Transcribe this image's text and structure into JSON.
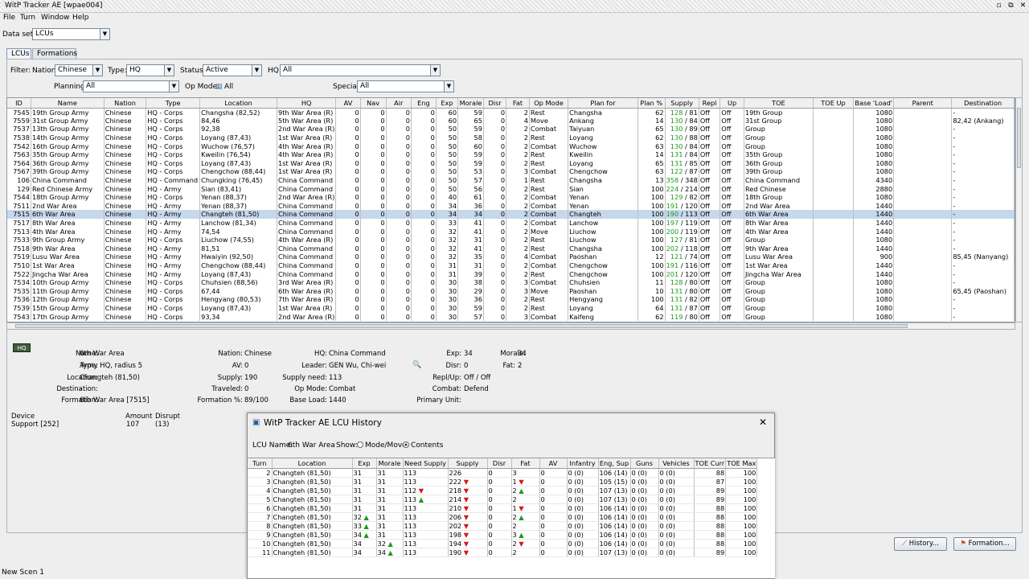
{
  "window": {
    "title": "WitP Tracker AE [wpae004]"
  },
  "menu": [
    "File",
    "Turn",
    "Window",
    "Help"
  ],
  "dataset": {
    "label": "Data set:",
    "value": "LCUs"
  },
  "tabs": [
    "LCUs",
    "Formations"
  ],
  "filter": {
    "label": "Filter:",
    "nation_label": "Nation:",
    "nation": "Chinese",
    "type_label": "Type:",
    "type": "HQ",
    "status_label": "Status:",
    "status": "Active",
    "hq_label": "HQ:",
    "hq": "All",
    "planning_label": "Planning:",
    "planning": "All",
    "opmode_label": "Op Mode:",
    "opmode": "All",
    "special_label": "Special:",
    "special": "All"
  },
  "grid": {
    "columns": [
      "ID",
      "Name",
      "Nation",
      "Type",
      "Location",
      "HQ",
      "AV",
      "Nav",
      "Air",
      "Eng",
      "Exp",
      "Morale",
      "Disr",
      "Fat",
      "Op Mode",
      "Plan for",
      "Plan %",
      "Supply",
      "Repl",
      "Up",
      "TOE",
      "TOE Up",
      "Base 'Load'",
      "Parent",
      "Destination"
    ],
    "rows": [
      [
        "7545",
        "19th Group Army",
        "Chinese",
        "HQ - Corps",
        "Changsha (82,52)",
        "9th War Area (R)",
        "0",
        "0",
        "0",
        "0",
        "60",
        "59",
        "0",
        "2",
        "Rest",
        "Changsha",
        "62",
        "128 / 81",
        "Off",
        "Off",
        "19th Group",
        "",
        "1080",
        "",
        "-"
      ],
      [
        "7559",
        "31st Group Army",
        "Chinese",
        "HQ - Corps",
        "84,46",
        "5th War Area (R)",
        "0",
        "0",
        "0",
        "0",
        "60",
        "65",
        "0",
        "4",
        "Move",
        "Ankang",
        "14",
        "130 / 84",
        "Off",
        "Off",
        "31st Group",
        "",
        "1080",
        "",
        "82,42 (Ankang)"
      ],
      [
        "7537",
        "13th Group Army",
        "Chinese",
        "HQ - Corps",
        "92,38",
        "2nd War Area (R)",
        "0",
        "0",
        "0",
        "0",
        "50",
        "59",
        "0",
        "2",
        "Combat",
        "Taiyuan",
        "65",
        "130 / 89",
        "Off",
        "Off",
        "Group",
        "",
        "1080",
        "",
        "-"
      ],
      [
        "7538",
        "14th Group Army",
        "Chinese",
        "HQ - Corps",
        "Loyang (87,43)",
        "1st War Area (R)",
        "0",
        "0",
        "0",
        "0",
        "50",
        "58",
        "0",
        "2",
        "Rest",
        "Loyang",
        "62",
        "130 / 88",
        "Off",
        "Off",
        "Group",
        "",
        "1080",
        "",
        "-"
      ],
      [
        "7542",
        "16th Group Army",
        "Chinese",
        "HQ - Corps",
        "Wuchow (76,57)",
        "4th War Area (R)",
        "0",
        "0",
        "0",
        "0",
        "50",
        "60",
        "0",
        "2",
        "Combat",
        "Wuchow",
        "63",
        "130 / 84",
        "Off",
        "Off",
        "Group",
        "",
        "1080",
        "",
        "-"
      ],
      [
        "7563",
        "35th Group Army",
        "Chinese",
        "HQ - Corps",
        "Kweilin (76,54)",
        "4th War Area (R)",
        "0",
        "0",
        "0",
        "0",
        "50",
        "59",
        "0",
        "2",
        "Rest",
        "Kweilin",
        "14",
        "131 / 84",
        "Off",
        "Off",
        "35th Group",
        "",
        "1080",
        "",
        "-"
      ],
      [
        "7564",
        "36th Group Army",
        "Chinese",
        "HQ - Corps",
        "Loyang (87,43)",
        "1st War Area (R)",
        "0",
        "0",
        "0",
        "0",
        "50",
        "59",
        "0",
        "2",
        "Rest",
        "Loyang",
        "65",
        "131 / 85",
        "Off",
        "Off",
        "36th Group",
        "",
        "1080",
        "",
        "-"
      ],
      [
        "7567",
        "39th Group Army",
        "Chinese",
        "HQ - Corps",
        "Chengchow (88,44)",
        "1st War Area (R)",
        "0",
        "0",
        "0",
        "0",
        "50",
        "53",
        "0",
        "3",
        "Combat",
        "Chengchow",
        "63",
        "122 / 87",
        "Off",
        "Off",
        "39th Group",
        "",
        "1080",
        "",
        "-"
      ],
      [
        "106",
        "China Command",
        "Chinese",
        "HQ - Command",
        "Chungking (76,45)",
        "China Command",
        "0",
        "0",
        "0",
        "0",
        "50",
        "57",
        "0",
        "1",
        "Rest",
        "Changsha",
        "13",
        "358 / 348",
        "Off",
        "Off",
        "China Command",
        "",
        "4340",
        "",
        "-"
      ],
      [
        "129",
        "Red Chinese Army",
        "Chinese",
        "HQ - Army",
        "Sian (83,41)",
        "China Command",
        "0",
        "0",
        "0",
        "0",
        "50",
        "56",
        "0",
        "2",
        "Rest",
        "Sian",
        "100",
        "224 / 214",
        "Off",
        "Off",
        "Red Chinese",
        "",
        "2880",
        "",
        "-"
      ],
      [
        "7544",
        "18th Group Army",
        "Chinese",
        "HQ - Corps",
        "Yenan (88,37)",
        "2nd War Area (R)",
        "0",
        "0",
        "0",
        "0",
        "40",
        "61",
        "0",
        "2",
        "Combat",
        "Yenan",
        "100",
        "129 / 82",
        "Off",
        "Off",
        "18th Group",
        "",
        "1080",
        "",
        "-"
      ],
      [
        "7511",
        "2nd War Area",
        "Chinese",
        "HQ - Army",
        "Yenan (88,37)",
        "China Command",
        "0",
        "0",
        "0",
        "0",
        "34",
        "36",
        "0",
        "2",
        "Combat",
        "Yenan",
        "100",
        "191 / 120",
        "Off",
        "Off",
        "2nd War Area",
        "",
        "1440",
        "",
        "-"
      ],
      [
        "7515",
        "6th War Area",
        "Chinese",
        "HQ - Army",
        "Changteh (81,50)",
        "China Command",
        "0",
        "0",
        "0",
        "0",
        "34",
        "34",
        "0",
        "2",
        "Combat",
        "Changteh",
        "100",
        "190 / 113",
        "Off",
        "Off",
        "6th War Area",
        "",
        "1440",
        "",
        "-"
      ],
      [
        "7517",
        "8th War Area",
        "Chinese",
        "HQ - Army",
        "Lanchow (81,34)",
        "China Command",
        "0",
        "0",
        "0",
        "0",
        "33",
        "41",
        "0",
        "2",
        "Combat",
        "Lanchow",
        "100",
        "197 / 119",
        "Off",
        "Off",
        "8th War Area",
        "",
        "1440",
        "",
        "-"
      ],
      [
        "7513",
        "4th War Area",
        "Chinese",
        "HQ - Army",
        "74,54",
        "China Command",
        "0",
        "0",
        "0",
        "0",
        "32",
        "41",
        "0",
        "2",
        "Move",
        "Liuchow",
        "100",
        "200 / 119",
        "Off",
        "Off",
        "4th War Area",
        "",
        "1440",
        "",
        "-"
      ],
      [
        "7533",
        "9th Group Army",
        "Chinese",
        "HQ - Corps",
        "Liuchow (74,55)",
        "4th War Area (R)",
        "0",
        "0",
        "0",
        "0",
        "32",
        "31",
        "0",
        "2",
        "Rest",
        "Liuchow",
        "100",
        "127 / 81",
        "Off",
        "Off",
        "Group",
        "",
        "1080",
        "",
        "-"
      ],
      [
        "7518",
        "9th War Area",
        "Chinese",
        "HQ - Army",
        "81,51",
        "China Command",
        "0",
        "0",
        "0",
        "0",
        "32",
        "41",
        "0",
        "2",
        "Rest",
        "Changsha",
        "100",
        "202 / 118",
        "Off",
        "Off",
        "9th War Area",
        "",
        "1440",
        "",
        "-"
      ],
      [
        "7519",
        "Lusu War Area",
        "Chinese",
        "HQ - Army",
        "Hwaiyin (92,50)",
        "China Command",
        "0",
        "0",
        "0",
        "0",
        "32",
        "35",
        "0",
        "4",
        "Combat",
        "Paoshan",
        "12",
        "121 / 74",
        "Off",
        "Off",
        "Lusu War Area",
        "",
        "900",
        "",
        "85,45 (Nanyang)"
      ],
      [
        "7510",
        "1st War Area",
        "Chinese",
        "HQ - Army",
        "Chengchow (88,44)",
        "China Command",
        "0",
        "0",
        "0",
        "0",
        "31",
        "31",
        "0",
        "2",
        "Combat",
        "Chengchow",
        "100",
        "191 / 116",
        "Off",
        "Off",
        "1st War Area",
        "",
        "1440",
        "",
        "-"
      ],
      [
        "7522",
        "Jingcha War Area",
        "Chinese",
        "HQ - Army",
        "Loyang (87,43)",
        "China Command",
        "0",
        "0",
        "0",
        "0",
        "31",
        "39",
        "0",
        "2",
        "Rest",
        "Chengchow",
        "100",
        "201 / 120",
        "Off",
        "Off",
        "Jingcha War Area",
        "",
        "1440",
        "",
        "-"
      ],
      [
        "7534",
        "10th Group Army",
        "Chinese",
        "HQ - Corps",
        "Chuhsien (88,56)",
        "3rd War Area (R)",
        "0",
        "0",
        "0",
        "0",
        "30",
        "38",
        "0",
        "3",
        "Combat",
        "Chuhsien",
        "11",
        "128 / 80",
        "Off",
        "Off",
        "Group",
        "",
        "1080",
        "",
        "-"
      ],
      [
        "7535",
        "11th Group Army",
        "Chinese",
        "HQ - Corps",
        "67,44",
        "6th War Area (R)",
        "0",
        "0",
        "0",
        "0",
        "30",
        "29",
        "0",
        "3",
        "Move",
        "Paoshan",
        "10",
        "131 / 80",
        "Off",
        "Off",
        "Group",
        "",
        "1080",
        "",
        "65,45 (Paoshan)"
      ],
      [
        "7536",
        "12th Group Army",
        "Chinese",
        "HQ - Corps",
        "Hengyang (80,53)",
        "7th War Area (R)",
        "0",
        "0",
        "0",
        "0",
        "30",
        "36",
        "0",
        "2",
        "Rest",
        "Hengyang",
        "100",
        "131 / 82",
        "Off",
        "Off",
        "Group",
        "",
        "1080",
        "",
        "-"
      ],
      [
        "7539",
        "15th Group Army",
        "Chinese",
        "HQ - Corps",
        "Loyang (87,43)",
        "1st War Area (R)",
        "0",
        "0",
        "0",
        "0",
        "30",
        "59",
        "0",
        "2",
        "Rest",
        "Loyang",
        "64",
        "131 / 87",
        "Off",
        "Off",
        "Group",
        "",
        "1080",
        "",
        "-"
      ],
      [
        "7543",
        "17th Group Army",
        "Chinese",
        "HQ - Corps",
        "93,34",
        "2nd War Area (R)",
        "0",
        "0",
        "0",
        "0",
        "30",
        "57",
        "0",
        "3",
        "Combat",
        "Kaifeng",
        "62",
        "119 / 80",
        "Off",
        "Off",
        "Group",
        "",
        "1080",
        "",
        "-"
      ]
    ]
  },
  "details": {
    "badge": "HQ",
    "name_l": "Name:",
    "name": "6th War Area",
    "type_l": "Type:",
    "type": "Army HQ, radius 5",
    "location_l": "Location:",
    "location": "Changteh (81,50)",
    "destination_l": "Destination:",
    "destination": "-",
    "formation_l": "Formation:",
    "formation": "6th War Area [7515]",
    "nation_l": "Nation:",
    "nation": "Chinese",
    "av_l": "AV:",
    "av": "0",
    "supply_l": "Supply:",
    "supply": "190",
    "traveled_l": "Traveled:",
    "traveled": "0",
    "formpct_l": "Formation %:",
    "formpct": "89/100",
    "hq_l": "HQ:",
    "hq": "China Command",
    "leader_l": "Leader:",
    "leader": "GEN Wu, Chi-wei",
    "supplyneed_l": "Supply need:",
    "supplyneed": "113",
    "opmode_l": "Op Mode:",
    "opmode": "Combat",
    "baseload_l": "Base Load:",
    "baseload": "1440",
    "exp_l": "Exp:",
    "exp": "34",
    "disr_l": "Disr:",
    "disr": "0",
    "replup_l": "Repl/Up:",
    "replup": "Off / Off",
    "combat_l": "Combat:",
    "combat": "Defend",
    "primary_l": "Primary Unit:",
    "primary": "",
    "morale_l": "Morale:",
    "morale": "34",
    "fat_l": "Fat:",
    "fat": "2",
    "device_h": "Device",
    "amount_h": "Amount",
    "disrupt_h": "Disrupt",
    "device": "Support [252]",
    "amount": "107",
    "disrupt": "(13)"
  },
  "history": {
    "title": "WitP Tracker AE LCU History",
    "lcu_label": "LCU Name:",
    "lcu_name": "6th War Area",
    "show_label": "Show:",
    "opt1": "Mode/Move",
    "opt2": "Contents",
    "columns": [
      "Turn",
      "Location",
      "Exp",
      "Morale",
      "Need Supply",
      "Supply",
      "Disr",
      "Fat",
      "AV",
      "Infantry",
      "Eng, Sup",
      "Guns",
      "Vehicles",
      "TOE Curr",
      "TOE Max"
    ],
    "rows": [
      [
        "2",
        "Changteh (81,50)",
        "31",
        "31",
        "113",
        "226",
        "0",
        "3",
        "0",
        "0 (0)",
        "106 (14)",
        "0 (0)",
        "0 (0)",
        "88",
        "100"
      ],
      [
        "3",
        "Changteh (81,50)",
        "31",
        "31",
        "113",
        "222",
        "0",
        "1",
        "0",
        "0 (0)",
        "105 (15)",
        "0 (0)",
        "0 (0)",
        "87",
        "100"
      ],
      [
        "4",
        "Changteh (81,50)",
        "31",
        "31",
        "112",
        "218",
        "0",
        "2",
        "0",
        "0 (0)",
        "107 (13)",
        "0 (0)",
        "0 (0)",
        "89",
        "100"
      ],
      [
        "5",
        "Changteh (81,50)",
        "31",
        "31",
        "113",
        "214",
        "0",
        "2",
        "0",
        "0 (0)",
        "107 (13)",
        "0 (0)",
        "0 (0)",
        "89",
        "100"
      ],
      [
        "6",
        "Changteh (81,50)",
        "31",
        "31",
        "113",
        "210",
        "0",
        "1",
        "0",
        "0 (0)",
        "106 (14)",
        "0 (0)",
        "0 (0)",
        "88",
        "100"
      ],
      [
        "7",
        "Changteh (81,50)",
        "32",
        "31",
        "113",
        "206",
        "0",
        "2",
        "0",
        "0 (0)",
        "106 (14)",
        "0 (0)",
        "0 (0)",
        "88",
        "100"
      ],
      [
        "8",
        "Changteh (81,50)",
        "33",
        "31",
        "113",
        "202",
        "0",
        "2",
        "0",
        "0 (0)",
        "106 (14)",
        "0 (0)",
        "0 (0)",
        "88",
        "100"
      ],
      [
        "9",
        "Changteh (81,50)",
        "34",
        "31",
        "113",
        "198",
        "0",
        "3",
        "0",
        "0 (0)",
        "106 (14)",
        "0 (0)",
        "0 (0)",
        "88",
        "100"
      ],
      [
        "10",
        "Changteh (81,50)",
        "34",
        "32",
        "113",
        "194",
        "0",
        "2",
        "0",
        "0 (0)",
        "106 (14)",
        "0 (0)",
        "0 (0)",
        "88",
        "100"
      ],
      [
        "11",
        "Changteh (81,50)",
        "34",
        "34",
        "113",
        "190",
        "0",
        "2",
        "0",
        "0 (0)",
        "107 (13)",
        "0 (0)",
        "0 (0)",
        "89",
        "100"
      ]
    ],
    "trends": {
      "exp": [
        "",
        "",
        "",
        "",
        "",
        "up",
        "up",
        "up",
        "",
        ""
      ],
      "morale": [
        "",
        "",
        "",
        "",
        "",
        "",
        "",
        "",
        "up",
        "up"
      ],
      "need": [
        "",
        "",
        "dn",
        "up",
        "",
        "",
        "",
        "",
        "",
        ""
      ],
      "supply": [
        "",
        "dn",
        "dn",
        "dn",
        "dn",
        "dn",
        "dn",
        "dn",
        "dn",
        "dn"
      ],
      "fat": [
        "",
        "dn",
        "up",
        "",
        "dn",
        "up",
        "",
        "up",
        "dn",
        ""
      ]
    }
  },
  "buttons": {
    "history": "History...",
    "formation": "Formation..."
  },
  "status": "New Scen 1",
  "colors": {
    "selected_row": "#c5d8ec",
    "supply_green": "#1a9a1a",
    "trend_up": "#1a9a1a",
    "trend_down": "#d21a1a"
  }
}
